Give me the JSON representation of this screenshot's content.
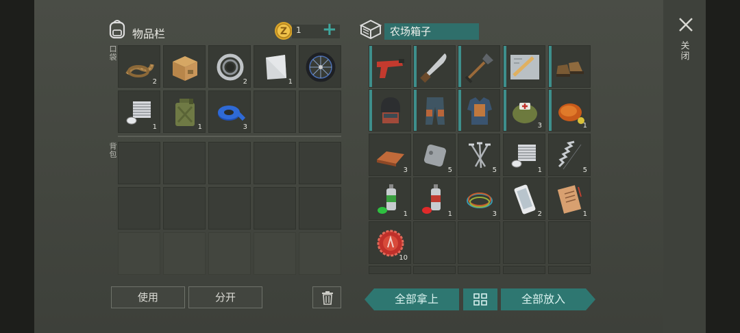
{
  "inventory": {
    "title": "物品栏",
    "coins": "1",
    "add_symbol": "+",
    "pocket_label": "口袋",
    "backpack_label": "背包",
    "pocket_items": [
      {
        "icon": "rope-icon",
        "count": "2"
      },
      {
        "icon": "cardboard-box-icon",
        "count": ""
      },
      {
        "icon": "bearing-icon",
        "count": "2"
      },
      {
        "icon": "metal-sheet-icon",
        "count": "1"
      },
      {
        "icon": "bicycle-wheel-icon",
        "count": ""
      },
      {
        "icon": "engine-cylinder-icon",
        "count": "1"
      },
      {
        "icon": "jerrycan-icon",
        "count": "1"
      },
      {
        "icon": "duct-tape-icon",
        "count": "3"
      }
    ],
    "use_button": "使用",
    "split_button": "分开"
  },
  "storage": {
    "title": "农场箱子",
    "items": [
      {
        "icon": "flare-gun-icon",
        "count": ""
      },
      {
        "icon": "machete-icon",
        "count": ""
      },
      {
        "icon": "shovel-icon",
        "count": ""
      },
      {
        "icon": "map-blueprint-icon",
        "count": ""
      },
      {
        "icon": "boots-icon",
        "count": ""
      },
      {
        "icon": "helmet-icon",
        "count": ""
      },
      {
        "icon": "armored-pants-icon",
        "count": ""
      },
      {
        "icon": "armor-vest-icon",
        "count": ""
      },
      {
        "icon": "first-aid-bag-icon",
        "count": "3"
      },
      {
        "icon": "roast-chicken-icon",
        "count": "1"
      },
      {
        "icon": "copper-ingot-icon",
        "count": "3"
      },
      {
        "icon": "metal-plate-icon",
        "count": "5"
      },
      {
        "icon": "nails-icon",
        "count": "5"
      },
      {
        "icon": "engine-cylinder-icon",
        "count": "1"
      },
      {
        "icon": "spring-icon",
        "count": "5"
      },
      {
        "icon": "spray-paint-green-icon",
        "count": "1"
      },
      {
        "icon": "spray-paint-red-icon",
        "count": "1"
      },
      {
        "icon": "wires-icon",
        "count": "3"
      },
      {
        "icon": "smartphone-icon",
        "count": "2"
      },
      {
        "icon": "diary-icon",
        "count": "1"
      },
      {
        "icon": "bottle-cap-icon",
        "count": "10"
      }
    ],
    "take_all_button": "全部拿上",
    "put_all_button": "全部放入"
  },
  "close_label": "关闭",
  "colors": {
    "teal": "#2e7771",
    "slot": "#373a34",
    "panel": "#474a43"
  }
}
